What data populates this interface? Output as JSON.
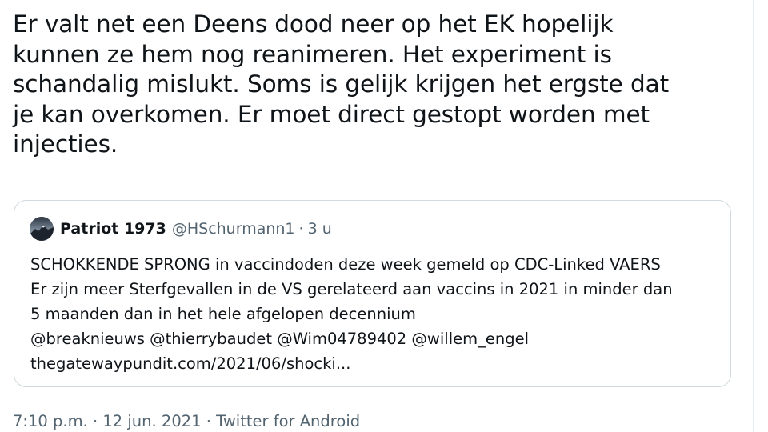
{
  "tweet": {
    "text": "Er valt net een Deens dood neer op het EK hopelijk\nkunnen ze hem nog reanimeren. Het experiment is\nschandalig mislukt. Soms is gelijk krijgen het ergste dat\nje kan overkomen. Er moet direct gestopt worden met\ninjecties."
  },
  "quoted_tweet": {
    "name": "Patriot 1973",
    "handle": "@HSchurmann1",
    "separator": "·",
    "time": "3 u",
    "lines": [
      "SCHOKKENDE SPRONG in vaccindoden deze week gemeld op CDC-Linked VAERS",
      "Er zijn meer Sterfgevallen in de VS gerelateerd aan vaccins in 2021 in minder dan",
      "5 maanden dan in het hele afgelopen decennium",
      "@breaknieuws @thierrybaudet @Wim04789402 @willem_engel",
      "thegatewaypundit.com/2021/06/shocki..."
    ]
  },
  "meta": {
    "time": "7:10 p.m.",
    "sep1": "·",
    "date": "12 jun. 2021",
    "sep2": "·",
    "source": "Twitter for Android"
  },
  "colors": {
    "text": "#0f1419",
    "secondary": "#536471",
    "border": "#cfd9de"
  },
  "icons": {
    "avatar": "mountain-avatar"
  }
}
